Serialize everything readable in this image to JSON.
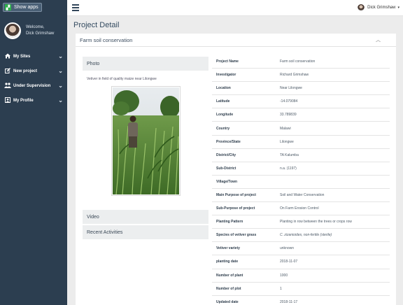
{
  "sidebar": {
    "show_apps_label": "Show apps",
    "welcome_line1": "Welcome,",
    "welcome_line2": "Dick Grimshaw",
    "items": [
      {
        "label": "My Sites",
        "icon": "home-icon"
      },
      {
        "label": "New project",
        "icon": "edit-icon"
      },
      {
        "label": "Under Supervision",
        "icon": "users-icon"
      },
      {
        "label": "My Profile",
        "icon": "user-icon"
      }
    ]
  },
  "topbar": {
    "user_name": "Dick Grimshaw"
  },
  "page": {
    "title": "Project Detail"
  },
  "project_card": {
    "title": "Farm soil conservation"
  },
  "left_panels": {
    "photo_heading": "Photo",
    "photo_caption": "Vetiver in field of quality maize near Lilongwe",
    "video_heading": "Video",
    "activities_heading": "Recent Activities"
  },
  "details": [
    {
      "label": "Project Name",
      "value": "Farm soil conservation"
    },
    {
      "label": "Investigator",
      "value": "Richard Grimshaw"
    },
    {
      "label": "Location",
      "value": "Near Lilongwe"
    },
    {
      "label": "Latitude",
      "value": "-14.079084"
    },
    {
      "label": "Longitude",
      "value": "33.789839"
    },
    {
      "label": "Country",
      "value": "Malawi"
    },
    {
      "label": "Province/State",
      "value": "Lilongwe"
    },
    {
      "label": "District/City",
      "value": "TA Kalumba"
    },
    {
      "label": "Sub-District",
      "value": "n.a. (1197)"
    },
    {
      "label": "Village/Town",
      "value": ""
    },
    {
      "label": "Main Purpose of project",
      "value": "Soil and Water Conservation"
    },
    {
      "label": "Sub-Purpose of project",
      "value": "On Farm Erosion Control"
    },
    {
      "label": "Planting Pattern",
      "value": "Planting in row between the trees or crops row"
    },
    {
      "label": "Species of vetiver grass",
      "value": "C. zizanioides, non-fertile (sterile)"
    },
    {
      "label": "Vetiver variety",
      "value": "unknown"
    },
    {
      "label": "planting date",
      "value": "2018-11-07"
    },
    {
      "label": "Number of plant",
      "value": "1000"
    },
    {
      "label": "Number of plot",
      "value": "1"
    },
    {
      "label": "Updated date",
      "value": "2018-11-17"
    }
  ],
  "colors": {
    "sidebar_bg": "#2c3e50",
    "app_icon": "#2fb24c",
    "panel_head_bg": "#eceeef"
  }
}
